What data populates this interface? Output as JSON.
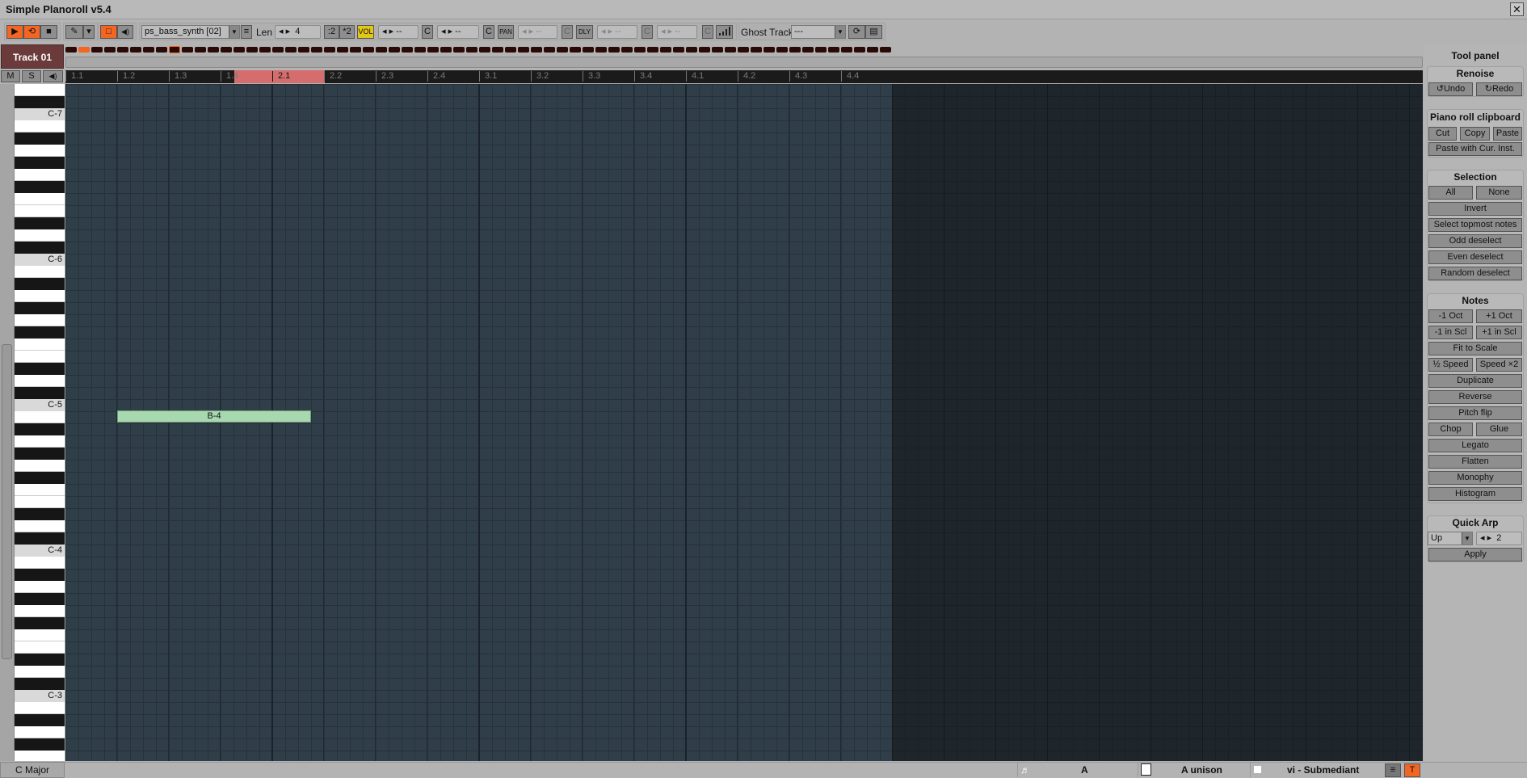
{
  "window": {
    "title": "Simple Planoroll v5.4",
    "close": "✕"
  },
  "toolbar": {
    "play": "▶",
    "loop": "⟲",
    "stop": "■",
    "pencil": "✎",
    "dropdown": "▾",
    "select": "□",
    "speaker": "◀)",
    "instrument": "ps_bass_synth [02]",
    "menu": "≡",
    "len_label": "Len",
    "len_value": "4",
    "div2": ":2",
    "mul2": "*2",
    "vol": "VOL",
    "vol_value": "--",
    "c": "C",
    "vol2_value": "--",
    "pan": "PAN",
    "pan_value": "--",
    "dly": "DLY",
    "dly_value": "--",
    "extra_value": "--",
    "ghost_label": "Ghost Track",
    "ghost_value": "---",
    "spin_arrows": "◂ ▸"
  },
  "track": {
    "name": "Track 01",
    "mute": "M",
    "solo": "S",
    "speaker": "◀)"
  },
  "pattern": {
    "count": 64,
    "active_index": 1,
    "selected_index": 8
  },
  "ruler": {
    "labels": [
      "1.1",
      "1.2",
      "1.3",
      "1.4",
      "2.1",
      "2.2",
      "2.3",
      "2.4",
      "3.1",
      "3.2",
      "3.3",
      "3.4",
      "4.1",
      "4.2",
      "4.3",
      "4.4"
    ]
  },
  "keys": {
    "octave_labels": [
      "C-7",
      "C-6",
      "C-5",
      "C-4",
      "C-3"
    ]
  },
  "notes": [
    {
      "label": "B-4",
      "start_beat": 1,
      "length_beats": 3.75
    }
  ],
  "panel": {
    "title": "Tool panel",
    "renoise": {
      "title": "Renoise",
      "undo": "↺Undo",
      "redo": "↻Redo"
    },
    "clipboard": {
      "title": "Piano roll clipboard",
      "cut": "Cut",
      "copy": "Copy",
      "paste": "Paste",
      "paste_inst": "Paste with Cur. Inst."
    },
    "selection": {
      "title": "Selection",
      "all": "All",
      "none": "None",
      "invert": "Invert",
      "topmost": "Select topmost notes",
      "odd": "Odd deselect",
      "even": "Even deselect",
      "random": "Random deselect"
    },
    "notes": {
      "title": "Notes",
      "oct_down": "-1 Oct",
      "oct_up": "+1 Oct",
      "scl_down": "-1 in Scl",
      "scl_up": "+1 in Scl",
      "fit": "Fit to Scale",
      "half": "½ Speed",
      "double": "Speed ×2",
      "duplicate": "Duplicate",
      "reverse": "Reverse",
      "pitchflip": "Pitch flip",
      "chop": "Chop",
      "glue": "Glue",
      "legato": "Legato",
      "flatten": "Flatten",
      "monophy": "Monophy",
      "histogram": "Histogram"
    },
    "arp": {
      "title": "Quick Arp",
      "mode": "Up",
      "value": "2",
      "apply": "Apply"
    }
  },
  "status": {
    "scale": "C Major",
    "key": "A",
    "chord": "A unison",
    "degree": "vi - Submediant",
    "menu": "≡",
    "t": "T"
  },
  "colors": {
    "accent": "#f26522",
    "note": "#a8d8b0",
    "loop": "#d46e6e",
    "track": "#6b3b3b"
  }
}
